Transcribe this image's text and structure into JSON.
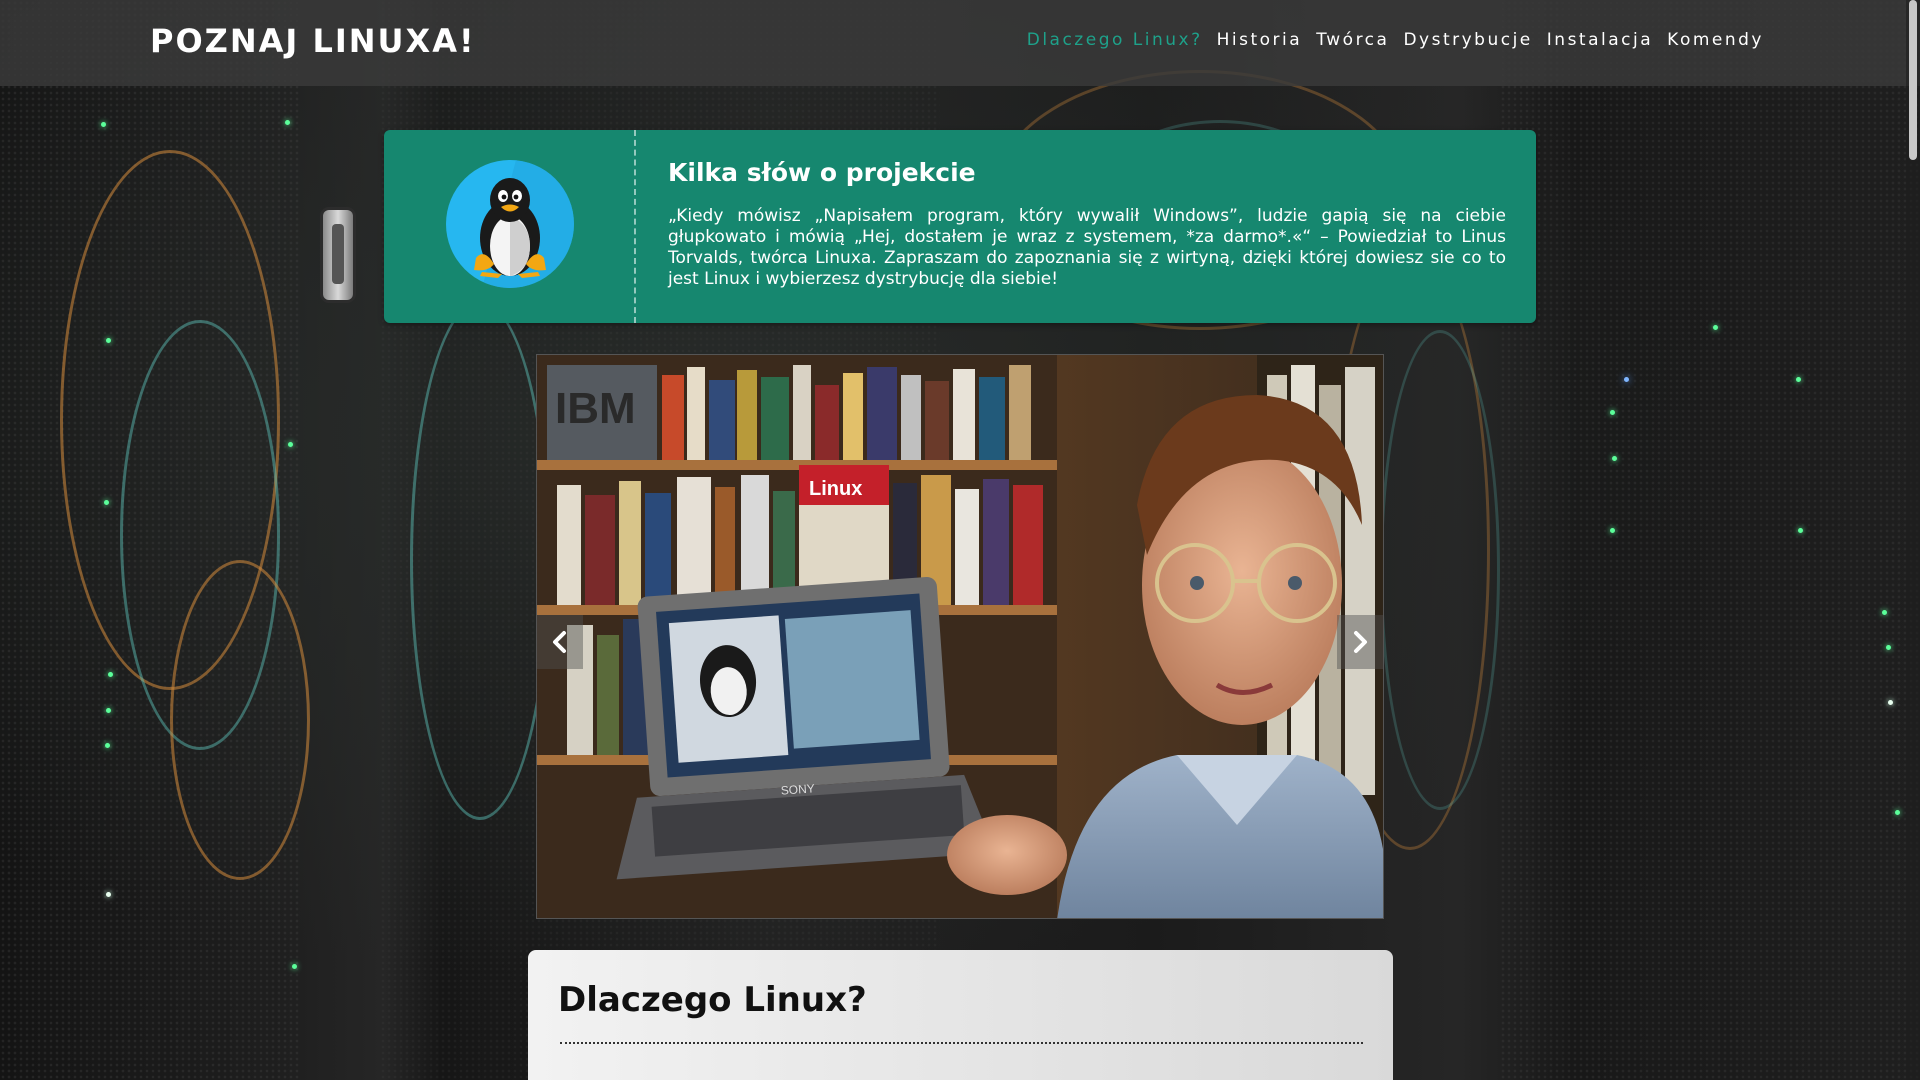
{
  "brand": {
    "title": "POZNAJ LINUXA!"
  },
  "nav": {
    "items": [
      {
        "label": "Dlaczego Linux?",
        "active": true
      },
      {
        "label": "Historia",
        "active": false
      },
      {
        "label": "Twórca",
        "active": false
      },
      {
        "label": "Dystrybucje",
        "active": false
      },
      {
        "label": "Instalacja",
        "active": false
      },
      {
        "label": "Komendy",
        "active": false
      }
    ]
  },
  "intro": {
    "title": "Kilka słów o projekcie",
    "text": "„Kiedy mówisz „Napisałem program, który wywalił Windows”, ludzie gapią się na ciebie głupkowato i mówią „Hej, dostałem je wraz z systemem, *za darmo*.«“ – Powiedział to Linus Torvalds, twórca Linuxa. Zapraszam do zapoznania się z wirtyną, dzięki której dowiesz sie co to jest Linux i wybierzesz dystrybucję dla siebie!",
    "logo_icon": "tux-penguin-icon"
  },
  "carousel": {
    "prev_icon": "chevron-left-icon",
    "next_icon": "chevron-right-icon",
    "photo_subject": "man-holding-laptop-photo",
    "photo_texts": {
      "ibm": "IBM",
      "book": "Linux"
    }
  },
  "section": {
    "title": "Dlaczego Linux?"
  },
  "colors": {
    "accent": "#1ea18a",
    "intro_bg": "#16876f",
    "tux_bg": "#26b7f0",
    "navbar_bg": "#3a3a3a"
  }
}
